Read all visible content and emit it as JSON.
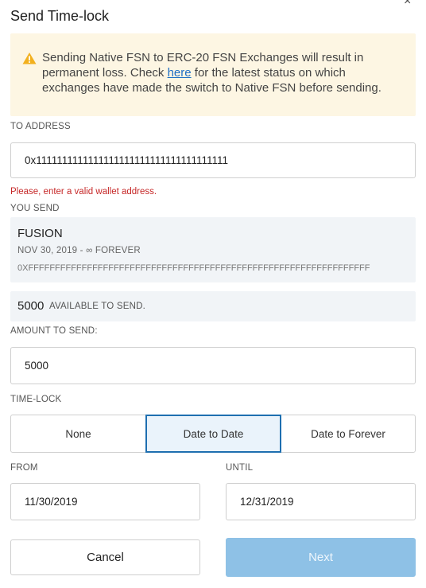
{
  "dialog": {
    "title": "Send Time-lock",
    "close_symbol": "×"
  },
  "warning": {
    "icon": "warning-triangle-icon",
    "text_before": "Sending Native FSN to ERC-20 FSN Exchanges will result in permanent loss. Check ",
    "link_label": "here",
    "text_after": " for the latest status on which exchanges have made the switch to Native FSN before sending."
  },
  "to_address": {
    "label": "TO ADDRESS",
    "value": "0x1111111111111111111111111111111111111",
    "error": "Please, enter a valid wallet address."
  },
  "you_send": {
    "label": "YOU SEND",
    "asset_name": "FUSION",
    "asset_date": "NOV 30, 2019 - ∞ FOREVER",
    "asset_id": "0XFFFFFFFFFFFFFFFFFFFFFFFFFFFFFFFFFFFFFFFFFFFFFFFFFFFFFFFFFFFFFFFF",
    "available_amount": "5000",
    "available_label": "AVAILABLE TO SEND."
  },
  "amount": {
    "label": "AMOUNT TO SEND:",
    "value": "5000"
  },
  "timelock": {
    "label": "TIME-LOCK",
    "options": [
      "None",
      "Date to Date",
      "Date to Forever"
    ],
    "selected": "Date to Date"
  },
  "from": {
    "label": "FROM",
    "value": "11/30/2019"
  },
  "until": {
    "label": "UNTIL",
    "value": "12/31/2019"
  },
  "actions": {
    "cancel_label": "Cancel",
    "next_label": "Next"
  },
  "colors": {
    "warning_bg": "#fdf6e3",
    "warning_icon": "#f2b01e",
    "link": "#1e6fc5",
    "error": "#c62828",
    "selected_border": "#1e6fb0",
    "next_disabled_bg": "#8ec1e6"
  }
}
